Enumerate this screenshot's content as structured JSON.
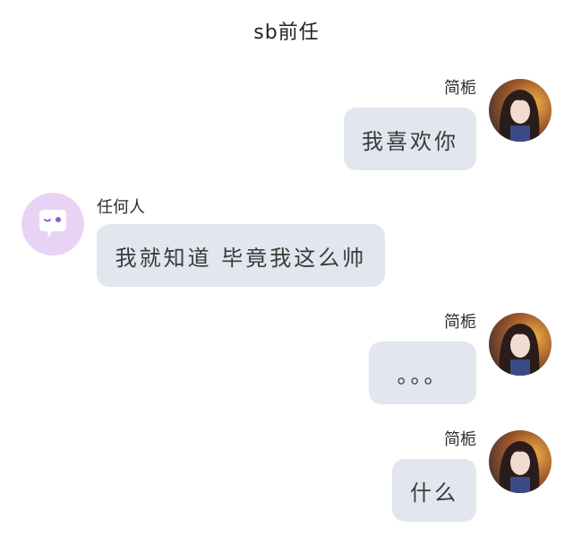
{
  "header": {
    "title": "sb前任"
  },
  "messages": [
    {
      "side": "self",
      "sender": "简栀",
      "text": "我喜欢你",
      "avatar_icon": "user-photo-avatar"
    },
    {
      "side": "other",
      "sender": "任何人",
      "text": "我就知道 毕竟我这么帅",
      "avatar_icon": "wink-chat-bubble-avatar"
    },
    {
      "side": "self",
      "sender": "简栀",
      "text": "。。。",
      "avatar_icon": "user-photo-avatar"
    },
    {
      "side": "self",
      "sender": "简栀",
      "text": "什么",
      "avatar_icon": "user-photo-avatar"
    }
  ],
  "colors": {
    "bubble": "#e2e6ee",
    "other_avatar_bg": "#e9d3f4",
    "other_avatar_icon": "#8a61c8"
  }
}
